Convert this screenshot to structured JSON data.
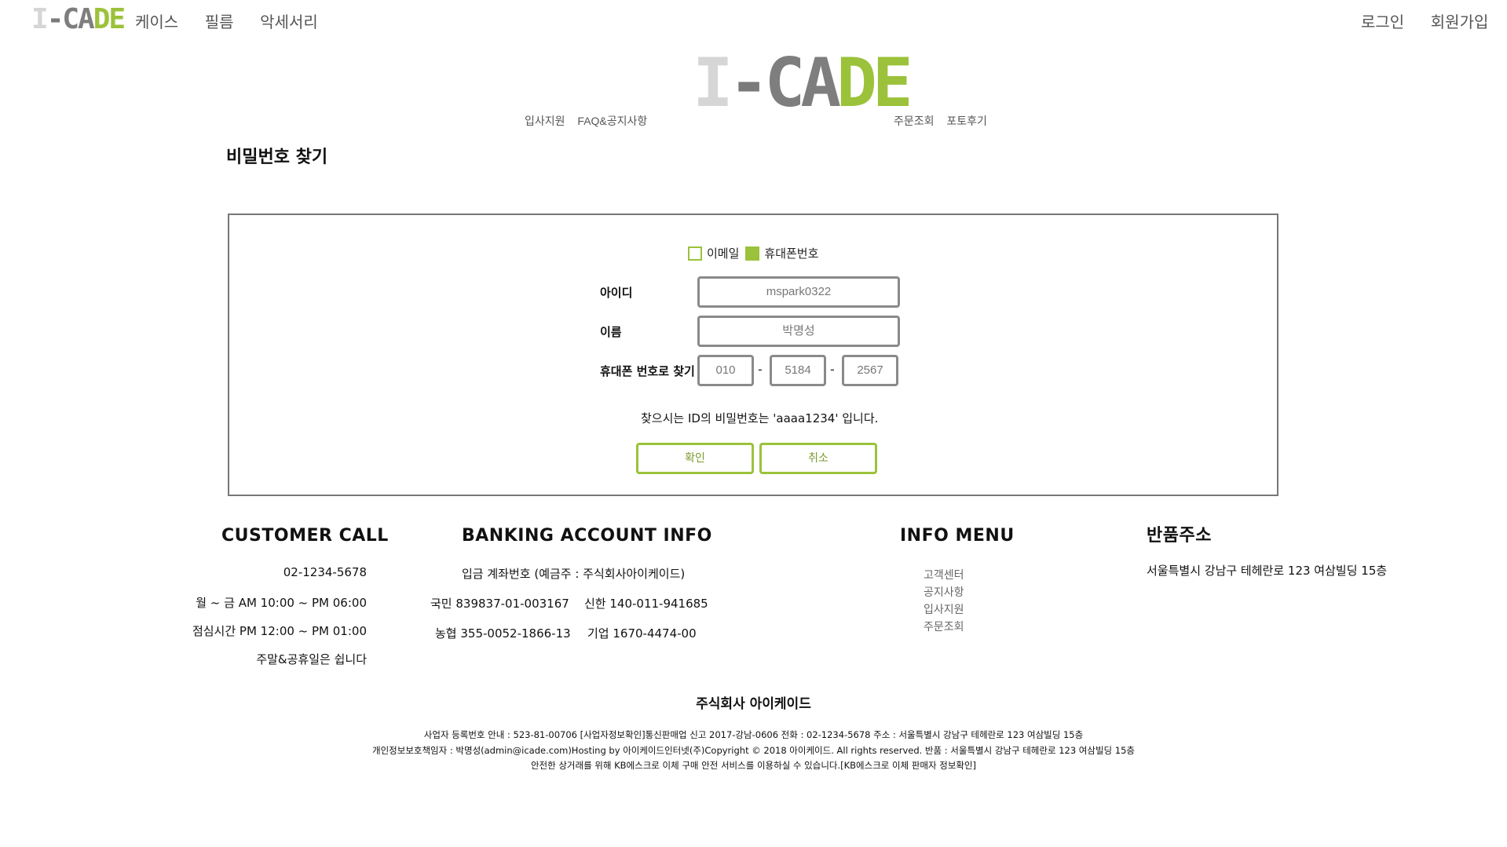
{
  "logo": {
    "part1": "I",
    "part2": "-",
    "part3": "CA",
    "part4": "DE"
  },
  "top_nav": {
    "left_items": [
      "케이스",
      "필름",
      "악세서리"
    ],
    "right_items": [
      "로그인",
      "회원가입"
    ]
  },
  "sub_nav": {
    "left_items": [
      "입사지원",
      "FAQ&공지사항"
    ],
    "right_items": [
      "주문조회",
      "포토후기"
    ]
  },
  "page": {
    "title": "비밀번호 찾기"
  },
  "form": {
    "options": [
      {
        "label": "이메일",
        "checked": false
      },
      {
        "label": "휴대폰번호",
        "checked": true
      }
    ],
    "id_label": "아이디",
    "id_value": "mspark0322",
    "name_label": "이름",
    "name_value": "박명성",
    "phone_label": "휴대폰 번호로 찾기",
    "phone_parts": [
      "010",
      "5184",
      "2567"
    ],
    "phone_sep": "-",
    "result_message": "찾으시는 ID의 비밀번호는 'aaaa1234' 입니다.",
    "confirm_label": "확인",
    "cancel_label": "취소"
  },
  "colors": {
    "accent": "#9bc23a",
    "border": "#777777",
    "muted_text": "#666666"
  },
  "footer": {
    "customer_call": {
      "heading": "CUSTOMER CALL",
      "lines": [
        "02-1234-5678",
        "월 ~ 금 AM 10:00 ~ PM 06:00",
        "점심시간 PM 12:00 ~ PM 01:00",
        "주말&공휴일은 쉽니다"
      ]
    },
    "banking": {
      "heading": "BANKING ACCOUNT INFO",
      "depositor": "입금 계좌번호 (예금주 : 주식회사아이케이드)",
      "accounts": [
        "국민 839837-01-003167",
        "신한 140-011-941685",
        "농협 355-0052-1866-13",
        "기업 1670-4474-00"
      ]
    },
    "info_menu": {
      "heading": "INFO MENU",
      "items": [
        "고객센터",
        "공지사항",
        "입사지원",
        "주문조회"
      ]
    },
    "return_address": {
      "heading": "반품주소",
      "address": "서울특별시 강남구 테헤란로 123 여삼빌딩 15층"
    },
    "company_name": "주식회사 아이케이드",
    "legal_lines": [
      "사업자 등록번호 안내 : 523-81-00706 [사업자정보확인]통신판매업 신고 2017-강남-0606 전화 : 02-1234-5678 주소 : 서울특별시 강남구 테헤란로 123 여삼빌딩 15층",
      "개인정보보호책임자 : 박명성(admin@icade.com)Hosting by 아이케이드인터넷(주)Copyright © 2018 아이케이드. All rights reserved. 반품 : 서울특별시 강남구 테헤란로 123 여삼빌딩 15층",
      "안전한 상거래를 위해 KB에스크로 이체 구매 안전 서비스를 이용하실 수 있습니다.[KB에스크로 이체 판매자 정보확인]"
    ]
  }
}
